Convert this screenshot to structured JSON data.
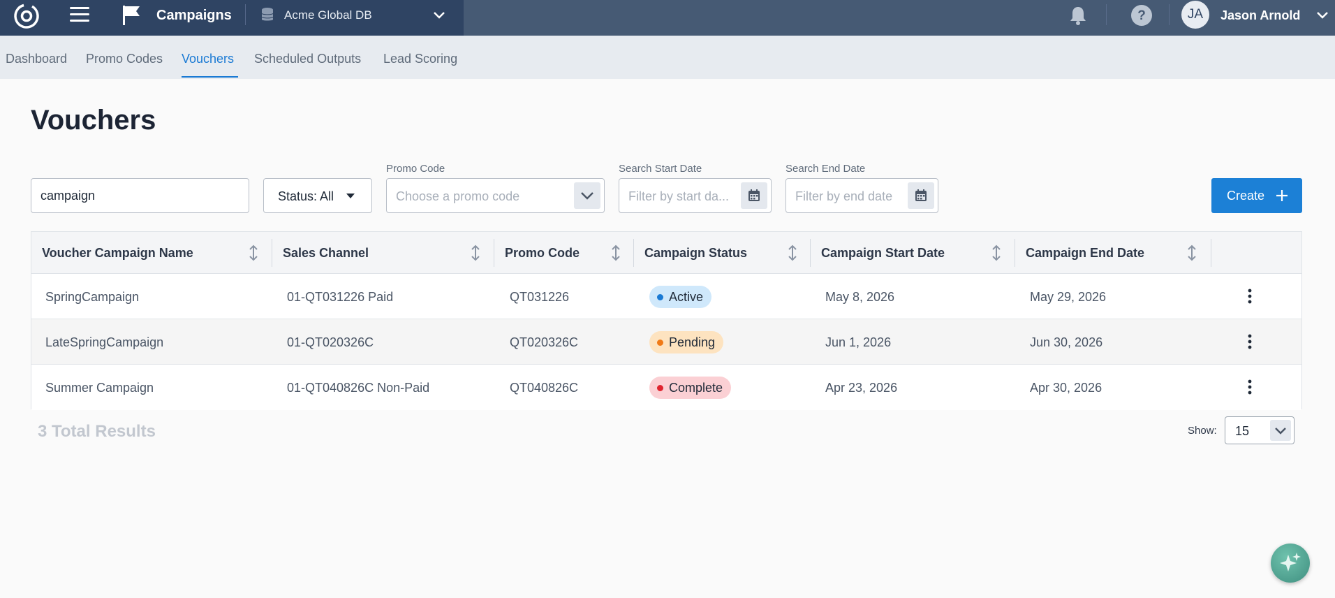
{
  "topbar": {
    "app_title": "Campaigns",
    "database_name": "Acme Global DB",
    "user_initials": "JA",
    "user_name": "Jason Arnold"
  },
  "subnav": {
    "tabs": [
      {
        "label": "Dashboard"
      },
      {
        "label": "Promo Codes"
      },
      {
        "label": "Vouchers",
        "active": true
      },
      {
        "label": "Scheduled Outputs"
      },
      {
        "label": "Lead Scoring"
      }
    ]
  },
  "page": {
    "title": "Vouchers"
  },
  "filters": {
    "search_value": "campaign",
    "status_label": "Status: All",
    "promo_code_label": "Promo Code",
    "promo_code_placeholder": "Choose a promo code",
    "start_date_label": "Search Start Date",
    "start_date_placeholder": "Filter by start da...",
    "end_date_label": "Search End Date",
    "end_date_placeholder": "Filter by end date",
    "create_label": "Create"
  },
  "table": {
    "columns": [
      "Voucher Campaign Name",
      "Sales Channel",
      "Promo Code",
      "Campaign Status",
      "Campaign Start Date",
      "Campaign End Date"
    ],
    "rows": [
      {
        "name": "SpringCampaign",
        "channel": "01-QT031226 Paid",
        "promo": "QT031226",
        "status": "Active",
        "start": "May 8, 2026",
        "end": "May 29, 2026"
      },
      {
        "name": "LateSpringCampaign",
        "channel": "01-QT020326C",
        "promo": "QT020326C",
        "status": "Pending",
        "start": "Jun 1, 2026",
        "end": "Jun 30, 2026"
      },
      {
        "name": "Summer Campaign",
        "channel": "01-QT040826C Non-Paid",
        "promo": "QT040826C",
        "status": "Complete",
        "start": "Apr 23, 2026",
        "end": "Apr 30, 2026"
      }
    ]
  },
  "status_colors": {
    "Active": {
      "bg": "#cfe8fb",
      "dot": "#1a7ad4"
    },
    "Pending": {
      "bg": "#fde3c0",
      "dot": "#f07a17"
    },
    "Complete": {
      "bg": "#fbd0d4",
      "dot": "#e0242f"
    }
  },
  "footer": {
    "total_results": "3 Total Results",
    "show_label": "Show:",
    "page_size": "15"
  },
  "colors": {
    "topbar": "#2f4463",
    "accent": "#1c80d6"
  }
}
